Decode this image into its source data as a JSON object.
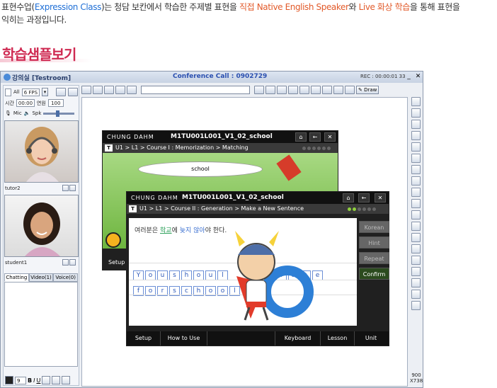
{
  "intro": {
    "line1_a": "표현수업(",
    "line1_b": "Expression Class",
    "line1_c": ")는 청담 보칸에서 학습한 주제별 표현을",
    "line1_d": "직접 Native English Speaker",
    "line1_e": "와",
    "line1_f": "Live 화상 학습",
    "line1_g": "을 통해 표현을",
    "line2": "익히는 과정입니다."
  },
  "heading": "학습샘플보기",
  "window": {
    "room": "강의실 [Testroom]",
    "conference_call": "Conference Call : 0902729",
    "rec": "REC : 00:00:01 33",
    "minimize": "_",
    "close": "✕"
  },
  "left_panel": {
    "all_label": "All",
    "fps": "6 FPS",
    "time_label": "시간",
    "time_value": "00:00",
    "won_label": "연원",
    "won_value": "100",
    "mic_label": "Mic",
    "spk_label": "Spk",
    "tutor_label": "tutor2",
    "student_label": "student1",
    "tabs": [
      "Chatting",
      "Video(1)",
      "Voice(0)"
    ],
    "font_size": "9"
  },
  "toolbar": {
    "draw_label": "Draw"
  },
  "coords": {
    "w": "900",
    "h": "X738"
  },
  "app_back": {
    "brand": "CHUNG DAHM",
    "code": "M1TU001L001_V1_02_school",
    "crumb": "U1 > L1 > Course I : Memorization > Matching",
    "word": "school"
  },
  "app_front": {
    "brand": "CHUNG DAHM",
    "code": "M1TU001L001_V1_02_school",
    "crumb": "U1 > L1 > Course II : Generation > Make a New Sentence",
    "sentence_a": "여러분은",
    "sentence_b": "학교",
    "sentence_c": "에",
    "sentence_d": "늦지 않아",
    "sentence_e": "야 한다.",
    "row1": [
      "Y",
      "o",
      "u",
      "s",
      "h",
      "o",
      "u",
      "l"
    ],
    "row1_tail": [
      "l",
      "a",
      "t",
      "e"
    ],
    "row2": [
      "f",
      "o",
      "r",
      "s",
      "c",
      "h",
      "o",
      "o",
      "l"
    ],
    "buttons": [
      "Korean",
      "Hint",
      "Repeat",
      "Confirm"
    ],
    "footer": [
      "Setup",
      "How to Use",
      "Keyboard",
      "Lesson",
      "Unit"
    ]
  }
}
